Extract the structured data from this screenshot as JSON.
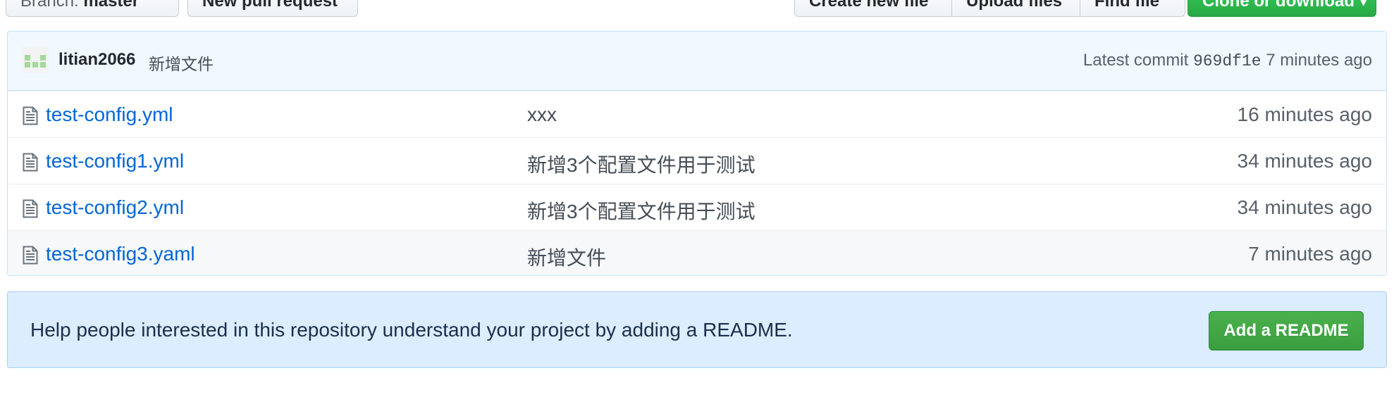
{
  "toolbar": {
    "branch_prefix": "Branch:",
    "branch_name": "master",
    "new_pull_request": "New pull request",
    "create_new_file": "Create new file",
    "upload_files": "Upload files",
    "find_file": "Find file",
    "clone_or_download": "Clone or download ▾"
  },
  "commit": {
    "author": "litian2066",
    "message": "新增文件",
    "latest_label": "Latest commit",
    "sha": "969df1e",
    "age": "7 minutes ago"
  },
  "files": [
    {
      "name": "test-config.yml",
      "message": "xxx",
      "age": "16 minutes ago"
    },
    {
      "name": "test-config1.yml",
      "message": "新增3个配置文件用于测试",
      "age": "34 minutes ago"
    },
    {
      "name": "test-config2.yml",
      "message": "新增3个配置文件用于测试",
      "age": "34 minutes ago"
    },
    {
      "name": "test-config3.yaml",
      "message": "新增文件",
      "age": "7 minutes ago"
    }
  ],
  "readme": {
    "prompt": "Help people interested in this repository understand your project by adding a README.",
    "button": "Add a README"
  },
  "colors": {
    "link": "#0366d6",
    "commit_bg": "#f1f8ff",
    "readme_bg": "#dbedff",
    "primary_green": "#28a745"
  }
}
